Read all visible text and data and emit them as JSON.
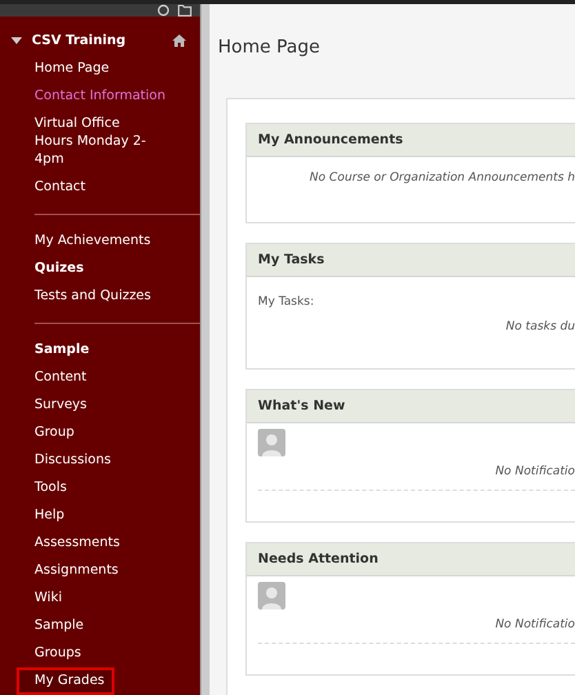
{
  "sidebar": {
    "items": [
      {
        "kind": "heading",
        "label": "CSV Training",
        "expanded": true
      },
      {
        "kind": "link",
        "label": "Home Page",
        "active": false,
        "highlighted": false
      },
      {
        "kind": "link",
        "label": "Contact Information",
        "active": true,
        "highlighted": false
      },
      {
        "kind": "link",
        "label": "Virtual Office Hours Monday 2-4pm",
        "active": false,
        "highlighted": false
      },
      {
        "kind": "link",
        "label": "Contact",
        "active": false,
        "highlighted": false
      },
      {
        "kind": "divider"
      },
      {
        "kind": "link",
        "label": "My Achievements",
        "active": false,
        "highlighted": false
      },
      {
        "kind": "section",
        "label": "Quizes"
      },
      {
        "kind": "link",
        "label": "Tests and Quizzes",
        "active": false,
        "highlighted": false
      },
      {
        "kind": "divider"
      },
      {
        "kind": "section",
        "label": "Sample"
      },
      {
        "kind": "link",
        "label": "Content",
        "active": false,
        "highlighted": false
      },
      {
        "kind": "link",
        "label": "Surveys",
        "active": false,
        "highlighted": false
      },
      {
        "kind": "link",
        "label": "Group",
        "active": false,
        "highlighted": false
      },
      {
        "kind": "link",
        "label": "Discussions",
        "active": false,
        "highlighted": false
      },
      {
        "kind": "link",
        "label": "Tools",
        "active": false,
        "highlighted": false
      },
      {
        "kind": "link",
        "label": "Help",
        "active": false,
        "highlighted": false
      },
      {
        "kind": "link",
        "label": "Assessments",
        "active": false,
        "highlighted": false
      },
      {
        "kind": "link",
        "label": "Assignments",
        "active": false,
        "highlighted": false
      },
      {
        "kind": "link",
        "label": "Wiki",
        "active": false,
        "highlighted": false
      },
      {
        "kind": "link",
        "label": "Sample",
        "active": false,
        "highlighted": false
      },
      {
        "kind": "link",
        "label": "Groups",
        "active": false,
        "highlighted": false
      },
      {
        "kind": "link",
        "label": "My Grades",
        "active": false,
        "highlighted": true
      }
    ]
  },
  "page_title": "Home Page",
  "modules": [
    {
      "kind": "message",
      "title": "My Announcements",
      "message": "No Course or Organization Announcements h"
    },
    {
      "kind": "tasks",
      "title": "My Tasks",
      "label": "My Tasks:",
      "message": "No tasks du"
    },
    {
      "kind": "notifications",
      "title": "What's New",
      "message": "No Notificatio"
    },
    {
      "kind": "notifications",
      "title": "Needs Attention",
      "message": "No Notificatio"
    }
  ]
}
